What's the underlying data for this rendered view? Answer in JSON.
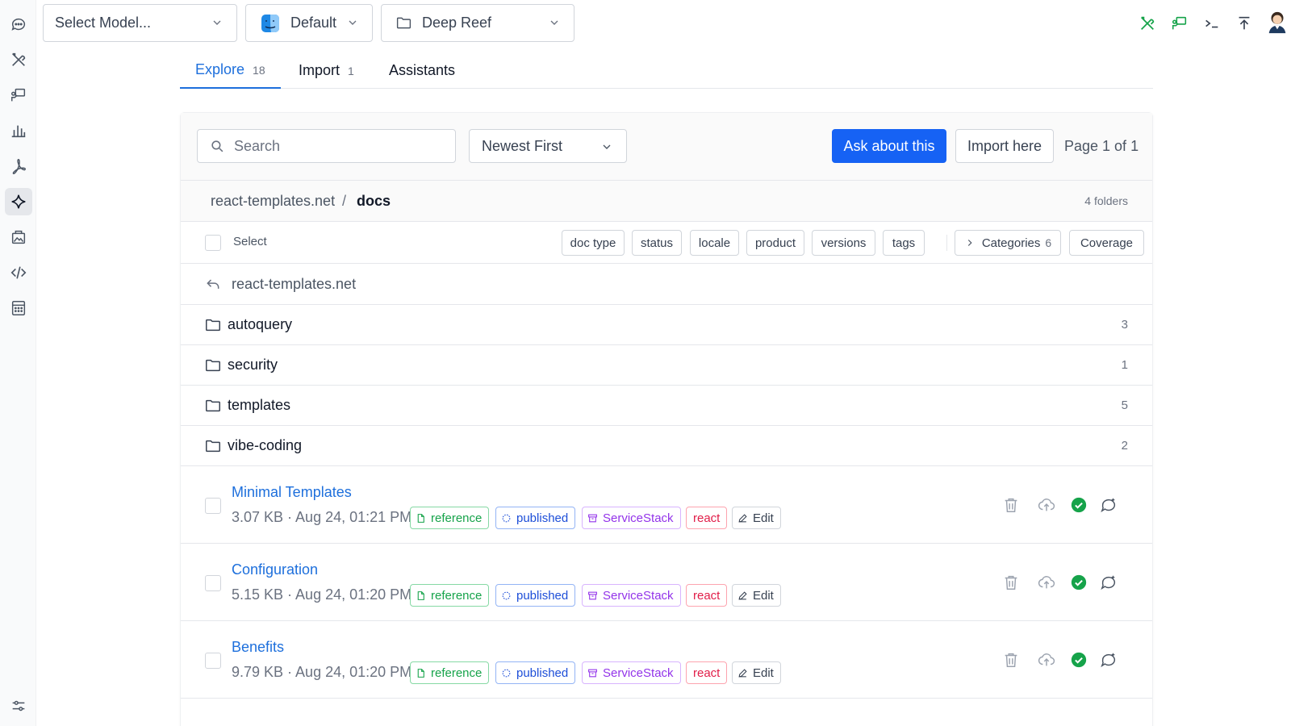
{
  "topbar": {
    "model_select": "Select Model...",
    "profile_select": "Default",
    "project_select": "Deep Reef"
  },
  "tabs": [
    {
      "label": "Explore",
      "count": "18"
    },
    {
      "label": "Import",
      "count": "1"
    },
    {
      "label": "Assistants",
      "count": ""
    }
  ],
  "toolbar": {
    "search_placeholder": "Search",
    "sort_value": "Newest First",
    "ask_label": "Ask about this",
    "import_label": "Import here",
    "page_text": "Page 1 of 1"
  },
  "breadcrumb": {
    "root": "react-templates.net",
    "separator": "/",
    "current": "docs",
    "folder_count": "4 folders"
  },
  "filters": {
    "select_label": "Select",
    "chips": [
      "doc type",
      "status",
      "locale",
      "product",
      "versions",
      "tags"
    ],
    "categories_label": "Categories",
    "categories_count": "6",
    "coverage_label": "Coverage"
  },
  "back_label": "react-templates.net",
  "folders": [
    {
      "name": "autoquery",
      "count": "3"
    },
    {
      "name": "security",
      "count": "1"
    },
    {
      "name": "templates",
      "count": "5"
    },
    {
      "name": "vibe-coding",
      "count": "2"
    }
  ],
  "docs": [
    {
      "title": "Minimal Templates",
      "meta": "3.07 KB · Aug 24, 01:21 PM",
      "type": "reference",
      "status": "published",
      "product": "ServiceStack",
      "tag": "react",
      "edit": "Edit"
    },
    {
      "title": "Configuration",
      "meta": "5.15 KB · Aug 24, 01:20 PM",
      "type": "reference",
      "status": "published",
      "product": "ServiceStack",
      "tag": "react",
      "edit": "Edit"
    },
    {
      "title": "Benefits",
      "meta": "9.79 KB · Aug 24, 01:20 PM",
      "type": "reference",
      "status": "published",
      "product": "ServiceStack",
      "tag": "react",
      "edit": "Edit"
    }
  ],
  "colors": {
    "accent": "#1662f4",
    "link": "#1d6fdc",
    "success": "#16a34a"
  }
}
